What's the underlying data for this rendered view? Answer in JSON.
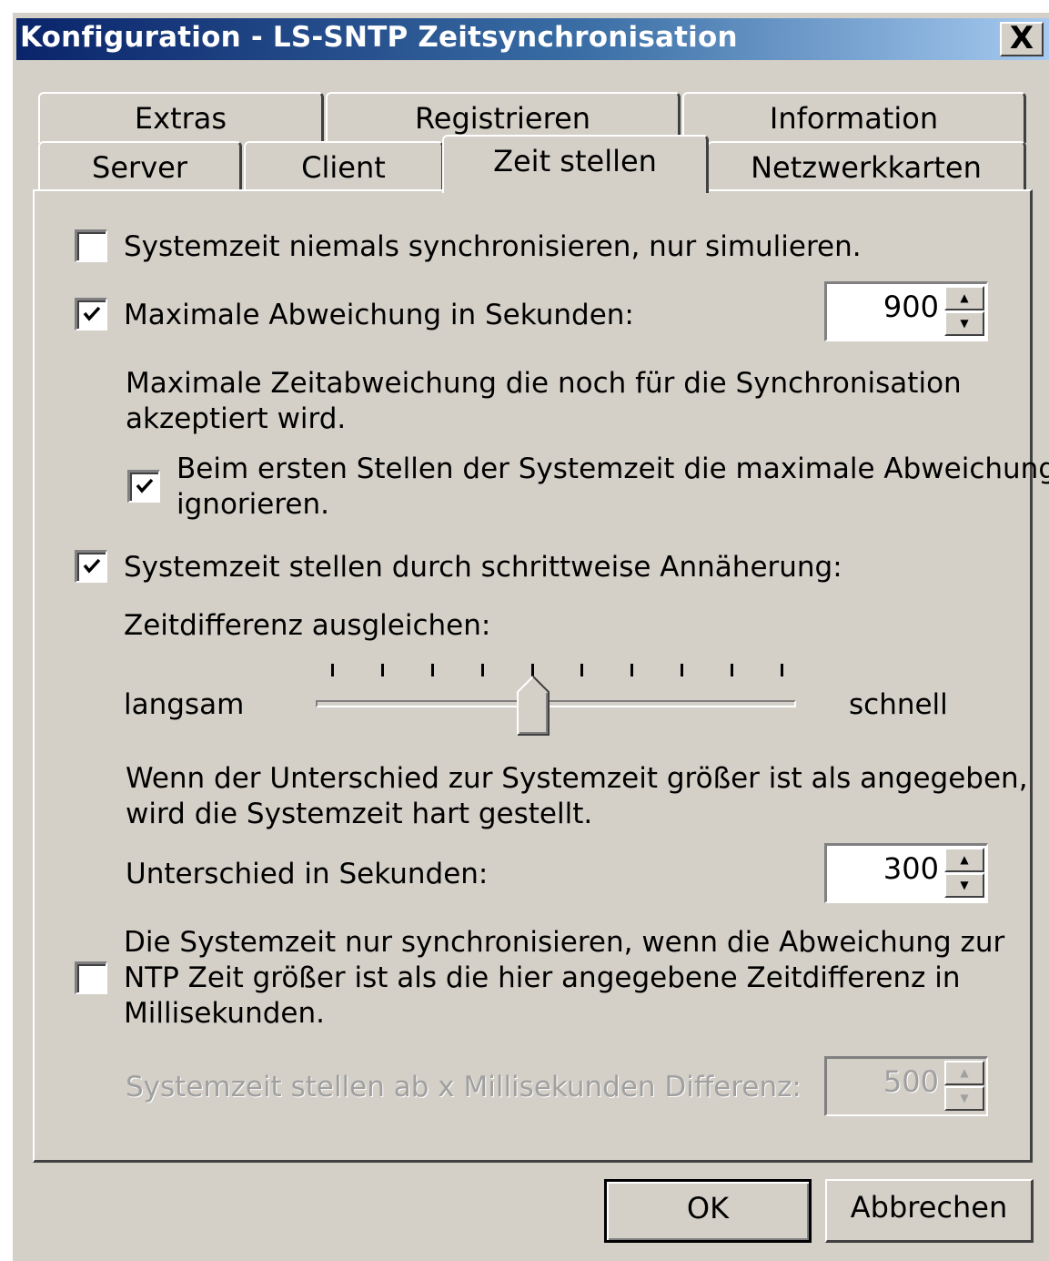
{
  "window": {
    "title": "Konfiguration - LS-SNTP Zeitsynchronisation",
    "close_label": "X"
  },
  "tabs_row1": [
    {
      "label": "Extras"
    },
    {
      "label": "Registrieren"
    },
    {
      "label": "Information"
    }
  ],
  "tabs_row2": [
    {
      "label": "Server"
    },
    {
      "label": "Client"
    },
    {
      "label": "Zeit stellen",
      "active": true
    },
    {
      "label": "Netzwerkkarten"
    }
  ],
  "options": {
    "simulate": {
      "label": "Systemzeit niemals synchronisieren, nur simulieren.",
      "checked": false
    },
    "max_deviation": {
      "label": "Maximale Abweichung in Sekunden:",
      "checked": true,
      "value": "900"
    },
    "max_deviation_desc_1": "Maximale Zeitabweichung die noch für die Synchronisation",
    "max_deviation_desc_2": "akzeptiert wird.",
    "ignore_first": {
      "label_1": "Beim ersten Stellen der Systemzeit die maximale Abweichung",
      "label_2": "ignorieren.",
      "checked": true
    },
    "gradual": {
      "label": "Systemzeit stellen durch schrittweise Annäherung:",
      "checked": true
    },
    "compensate_label": "Zeitdifferenz ausgleichen:",
    "slider": {
      "min_label": "langsam",
      "max_label": "schnell",
      "ticks": 10,
      "position_index": 4
    },
    "hard_desc_1": "Wenn der Unterschied zur Systemzeit größer ist als angegeben,",
    "hard_desc_2": "wird die Systemzeit hart gestellt.",
    "difference": {
      "label": "Unterschied in Sekunden:",
      "value": "300"
    },
    "sync_threshold": {
      "label_1": "Die Systemzeit nur synchronisieren, wenn die Abweichung zur",
      "label_2": "NTP Zeit größer ist als die hier angegebene Zeitdifferenz in",
      "label_3": "Millisekunden.",
      "checked": false
    },
    "ms_difference": {
      "label": "Systemzeit stellen ab x Millisekunden Differenz:",
      "value": "500",
      "disabled": true
    }
  },
  "buttons": {
    "ok": "OK",
    "cancel": "Abbrechen"
  }
}
